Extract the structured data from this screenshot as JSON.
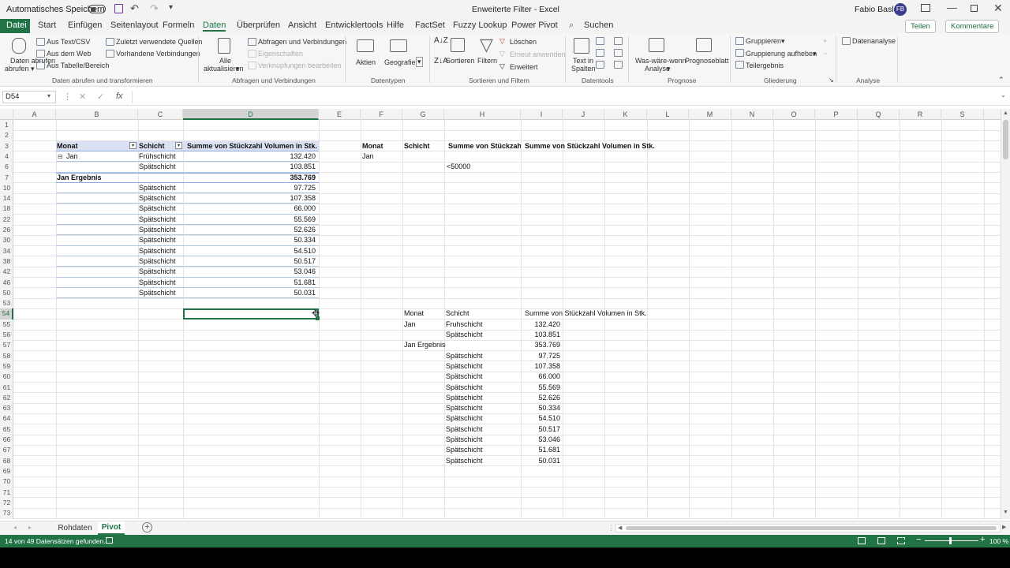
{
  "titlebar": {
    "autosave": "Automatisches Speichern",
    "title": "Enweiterte Filter  -  Excel",
    "user": "Fabio Basler",
    "initials": "FB"
  },
  "menubar": {
    "tabs": [
      "Datei",
      "Start",
      "Einfügen",
      "Seitenlayout",
      "Formeln",
      "Daten",
      "Überprüfen",
      "Ansicht",
      "Entwicklertools",
      "Hilfe",
      "FactSet",
      "Fuzzy Lookup",
      "Power Pivot"
    ],
    "search": "Suchen",
    "share": "Teilen",
    "comments": "Kommentare"
  },
  "ribbon": {
    "daten_abrufen": "Daten abrufen",
    "aus_text": "Aus Text/CSV",
    "aus_web": "Aus dem Web",
    "aus_tabelle": "Aus Tabelle/Bereich",
    "zuletzt": "Zuletzt verwendete Quellen",
    "vorhandene": "Vorhandene Verbindungen",
    "grp1": "Daten abrufen und transformieren",
    "alle": "Alle",
    "aktualisieren": "aktualisieren",
    "abfragen": "Abfragen und Verbindungen",
    "eigenschaften": "Eigenschaften",
    "verknuepfungen": "Verknüpfungen bearbeiten",
    "grp2": "Abfragen und Verbindungen",
    "aktien": "Aktien",
    "geografie": "Geografie",
    "grp3": "Datentypen",
    "sortieren": "Sortieren",
    "filtern": "Filtern",
    "loeschen": "Löschen",
    "erneut": "Erneut anwenden",
    "erweitert": "Erweitert",
    "grp4": "Sortieren und Filtern",
    "text_in": "Text in",
    "spalten": "Spalten",
    "grp5": "Datentools",
    "waswarewenn": "Was-wäre-wenn-",
    "analyse": "Analyse",
    "prognoseblatt": "Prognoseblatt",
    "grp6": "Prognose",
    "gruppieren": "Gruppieren",
    "gruppierung_auf": "Gruppierung aufheben",
    "teilergebnis": "Teilergebnis",
    "grp7": "Gliederung",
    "datenanalyse": "Datenanalyse",
    "grp8": "Analyse"
  },
  "formula_bar": {
    "name_box": "D54",
    "fx": "fx",
    "value": ""
  },
  "columns": [
    "A",
    "B",
    "C",
    "D",
    "E",
    "F",
    "G",
    "H",
    "I",
    "J",
    "K",
    "L",
    "M",
    "N",
    "O",
    "P",
    "Q",
    "R",
    "S"
  ],
  "rows": [
    "1",
    "2",
    "3",
    "4",
    "6",
    "7",
    "10",
    "14",
    "18",
    "22",
    "26",
    "30",
    "34",
    "38",
    "42",
    "46",
    "50",
    "53",
    "54",
    "55",
    "56",
    "57",
    "58",
    "59",
    "60",
    "61",
    "62",
    "63",
    "64",
    "65",
    "66",
    "67",
    "68",
    "69",
    "70",
    "71",
    "72",
    "73"
  ],
  "pivot": {
    "h_monat": "Monat",
    "h_schicht": "Schicht",
    "h_summe": "Summe von Stückzahl Volumen in Stk.",
    "rows": [
      {
        "b": "Jan",
        "c": "Frühschicht",
        "d": "132.420"
      },
      {
        "b": "",
        "c": "Spätschicht",
        "d": "103.851"
      },
      {
        "b": "Jan Ergebnis",
        "c": "",
        "d": "353.769"
      },
      {
        "b": "",
        "c": "Spätschicht",
        "d": "97.725"
      },
      {
        "b": "",
        "c": "Spätschicht",
        "d": "107.358"
      },
      {
        "b": "",
        "c": "Spätschicht",
        "d": "66.000"
      },
      {
        "b": "",
        "c": "Spätschicht",
        "d": "55.569"
      },
      {
        "b": "",
        "c": "Spätschicht",
        "d": "52.626"
      },
      {
        "b": "",
        "c": "Spätschicht",
        "d": "50.334"
      },
      {
        "b": "",
        "c": "Spätschicht",
        "d": "54.510"
      },
      {
        "b": "",
        "c": "Spätschicht",
        "d": "50.517"
      },
      {
        "b": "",
        "c": "Spätschicht",
        "d": "53.046"
      },
      {
        "b": "",
        "c": "Spätschicht",
        "d": "51.681"
      },
      {
        "b": "",
        "c": "Spätschicht",
        "d": "50.031"
      }
    ]
  },
  "criteria": {
    "h_monat": "Monat",
    "h_schicht": "Schicht",
    "h_summe1": "Summe von Stückzahl",
    "h_summe2": "Summe von Stückzahl Volumen in Stk.",
    "monat": "Jan",
    "summe": "<50000"
  },
  "output": {
    "h_monat": "Monat",
    "h_schicht": "Schicht",
    "h_summe": "Summe von Stückzahl Volumen in Stk.",
    "rows": [
      {
        "g": "Jan",
        "h": "Fruhschicht",
        "i": "132.420"
      },
      {
        "g": "",
        "h": "Spätschicht",
        "i": "103.851"
      },
      {
        "g": "Jan Ergebnis",
        "h": "",
        "i": "353.769"
      },
      {
        "g": "",
        "h": "Spätschicht",
        "i": "97.725"
      },
      {
        "g": "",
        "h": "Spätschicht",
        "i": "107.358"
      },
      {
        "g": "",
        "h": "Spätschicht",
        "i": "66.000"
      },
      {
        "g": "",
        "h": "Spätschicht",
        "i": "55.569"
      },
      {
        "g": "",
        "h": "Spätschicht",
        "i": "52.626"
      },
      {
        "g": "",
        "h": "Spätschicht",
        "i": "50.334"
      },
      {
        "g": "",
        "h": "Spätschicht",
        "i": "54.510"
      },
      {
        "g": "",
        "h": "Spätschicht",
        "i": "50.517"
      },
      {
        "g": "",
        "h": "Spätschicht",
        "i": "53.046"
      },
      {
        "g": "",
        "h": "Spätschicht",
        "i": "51.681"
      },
      {
        "g": "",
        "h": "Spätschicht",
        "i": "50.031"
      }
    ]
  },
  "sheets": {
    "tab1": "Rohdaten",
    "tab2": "Pivot"
  },
  "status": {
    "message": "14 von 49 Datensätzen gefunden.",
    "zoom": "100 %"
  },
  "colors": {
    "accent": "#217346",
    "pivot_header": "#d9e1f2"
  }
}
